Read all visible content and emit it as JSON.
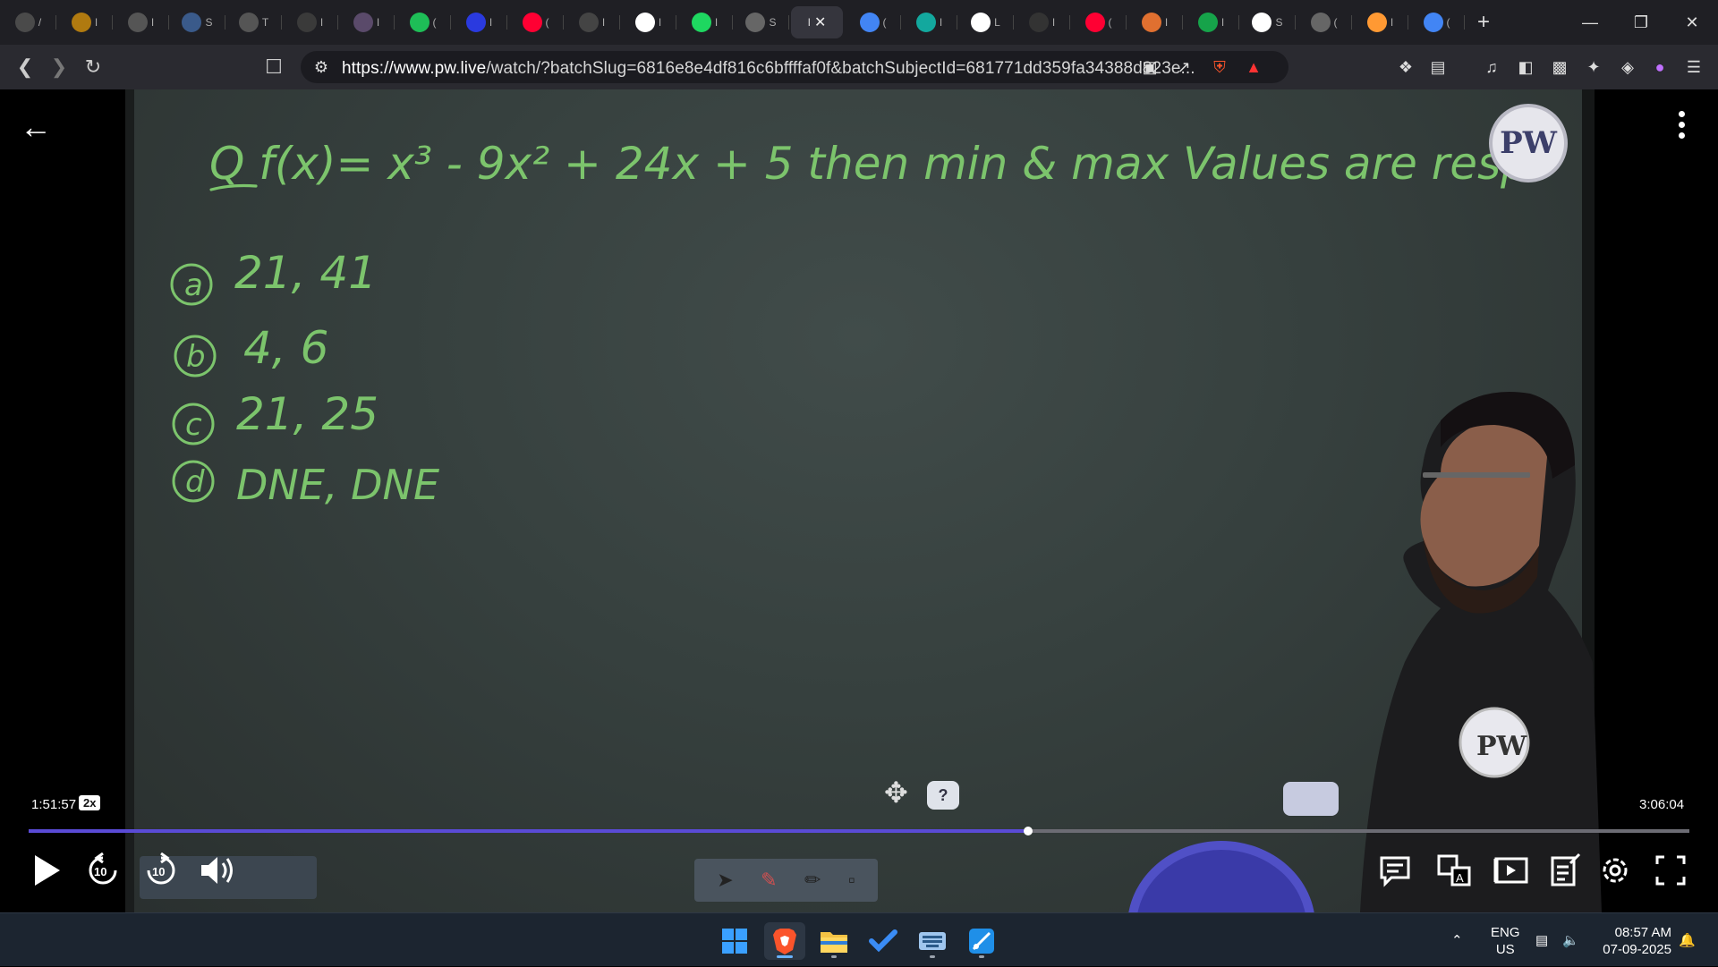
{
  "browser": {
    "tabs": [
      {
        "icon": "chatgpt-icon",
        "color": "#4a4a4a",
        "label": "/"
      },
      {
        "icon": "coin-icon",
        "color": "#b07a10",
        "label": "I"
      },
      {
        "icon": "globe-icon",
        "color": "#555555",
        "label": "I"
      },
      {
        "icon": "dashboard-icon",
        "color": "#3a5a8a",
        "label": "S"
      },
      {
        "icon": "w3schools-icon",
        "color": "#555555",
        "label": "T"
      },
      {
        "icon": "grid-icon",
        "color": "#3a3a3a",
        "label": "I"
      },
      {
        "icon": "profile-icon",
        "color": "#5a4a6a",
        "label": "I"
      },
      {
        "icon": "whatsapp-icon",
        "color": "#1ebe57",
        "label": "("
      },
      {
        "icon": "bookmark-icon",
        "color": "#2a3adf",
        "label": "I"
      },
      {
        "icon": "youtube-icon",
        "color": "#ff0033",
        "label": "("
      },
      {
        "icon": "spark-icon",
        "color": "#444444",
        "label": "I"
      },
      {
        "icon": "google-icon",
        "color": "#ffffff",
        "label": "I"
      },
      {
        "icon": "spotify-icon",
        "color": "#1ed760",
        "label": "I"
      },
      {
        "icon": "globe-icon",
        "color": "#666666",
        "label": "S"
      },
      {
        "icon": "active-tab-icon",
        "color": "#35353d",
        "label": "I"
      },
      {
        "icon": "gemini-icon",
        "color": "#4285f4",
        "label": "("
      },
      {
        "icon": "copilot-icon",
        "color": "#13a89e",
        "label": "I"
      },
      {
        "icon": "google-icon",
        "color": "#ffffff",
        "label": "L"
      },
      {
        "icon": "monitor-icon",
        "color": "#333333",
        "label": "I"
      },
      {
        "icon": "youtube-icon",
        "color": "#ff0033",
        "label": "("
      },
      {
        "icon": "ball-icon",
        "color": "#e07030",
        "label": "I"
      },
      {
        "icon": "chart-icon",
        "color": "#16a34a",
        "label": "I"
      },
      {
        "icon": "wikipedia-icon",
        "color": "#ffffff",
        "label": "S"
      },
      {
        "icon": "globe-icon",
        "color": "#666666",
        "label": "("
      },
      {
        "icon": "india-flag-icon",
        "color": "#ff9933",
        "label": "I"
      },
      {
        "icon": "gemini-icon",
        "color": "#4285f4",
        "label": "("
      }
    ],
    "url_host": "https://www.pw.live",
    "url_path": "/watch/?batchSlug=6816e8e4df816c6bffffaf0f&batchSubjectId=681771dd359fa34388d823e..."
  },
  "board": {
    "question": "Q f(x)= x³ - 9x² + 24x + 5 then min & max Values are resp.",
    "options": [
      {
        "key": "a",
        "value": "21, 41"
      },
      {
        "key": "b",
        "value": "4, 6"
      },
      {
        "key": "c",
        "value": "21, 25"
      },
      {
        "key": "d",
        "value": "DNE, DNE"
      }
    ],
    "logo_text": "PW",
    "ink_color": "#7cc46c"
  },
  "player": {
    "current_time": "1:51:57",
    "speed": "2x",
    "total_time": "3:06:04",
    "progress_fraction": 0.6019,
    "accent_color": "#5a4bd6",
    "rewind_label": "10",
    "forward_label": "10"
  },
  "taskbar": {
    "apps": [
      "windows-start-icon",
      "brave-icon",
      "file-explorer-icon",
      "todo-icon",
      "onscreen-keyboard-icon",
      "snipping-tool-icon"
    ],
    "lang_line1": "ENG",
    "lang_line2": "US",
    "time": "08:57 AM",
    "date": "07-09-2025"
  }
}
